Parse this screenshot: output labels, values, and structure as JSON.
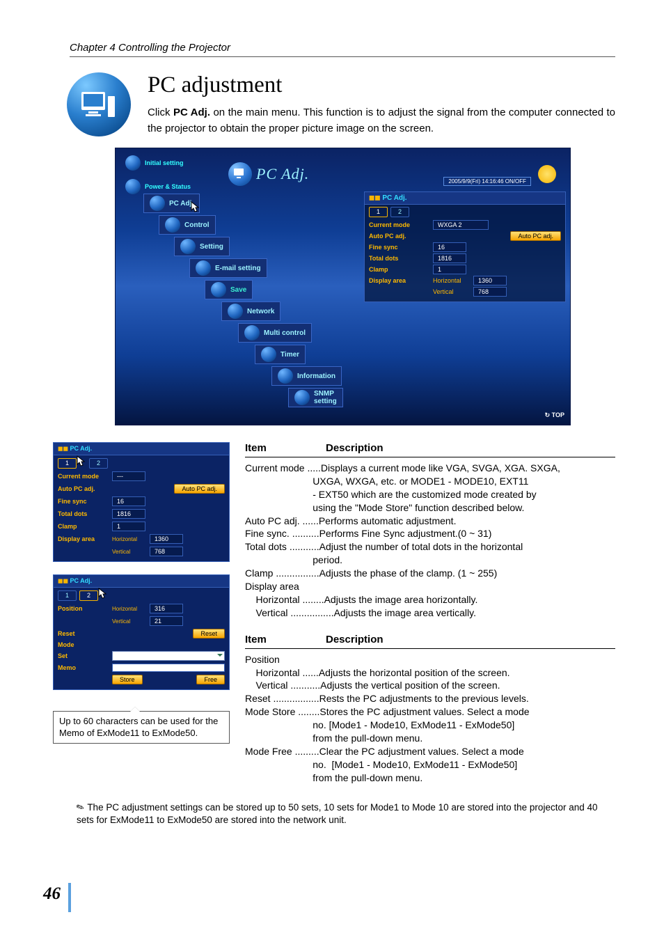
{
  "chapter": "Chapter 4 Controlling the Projector",
  "title": "PC adjustment",
  "intro_prefix": "Click ",
  "intro_bold": "PC Adj.",
  "intro_rest": " on the main menu. This function is to adjust the signal from the computer connected to the projector to obtain the proper picture image on the screen.",
  "ss": {
    "initial": "Initial setting",
    "power": "Power & Status",
    "big": "PC Adj.",
    "date": "2005/9/9(Fri)   14:16:46  ON/OFF",
    "nav": {
      "pcadj": "PC Adj.",
      "control": "Control",
      "setting": "Setting",
      "email": "E-mail setting",
      "save": "Save",
      "network": "Network",
      "multi": "Multi control",
      "timer": "Timer",
      "info": "Information",
      "snmp": "SNMP setting"
    },
    "panel": {
      "title": "PC Adj.",
      "t1": "1",
      "t2": "2",
      "current_mode": "Current mode",
      "current_mode_v": "WXGA 2",
      "auto_pc": "Auto PC adj.",
      "auto_pc_btn": "Auto PC adj.",
      "fine": "Fine sync",
      "fine_v": "16",
      "total": "Total dots",
      "total_v": "1816",
      "clamp": "Clamp",
      "clamp_v": "1",
      "disp": "Display area",
      "horiz": "Horizontal",
      "horiz_v": "1360",
      "vert": "Vertical",
      "vert_v": "768"
    },
    "top": "TOP"
  },
  "mini1": {
    "title": "PC Adj.",
    "t1": "1",
    "t2": "2",
    "current_mode": "Current mode",
    "current_mode_v": "---",
    "auto_pc": "Auto PC adj.",
    "auto_pc_btn": "Auto PC adj.",
    "fine": "Fine sync",
    "fine_v": "16",
    "total": "Total dots",
    "total_v": "1816",
    "clamp": "Clamp",
    "clamp_v": "1",
    "disp": "Display area",
    "horiz": "Horizontal",
    "horiz_v": "1360",
    "vert": "Vertical",
    "vert_v": "768"
  },
  "mini2": {
    "title": "PC Adj.",
    "t1": "1",
    "t2": "2",
    "pos": "Position",
    "horiz": "Horizontal",
    "horiz_v": "316",
    "vert": "Vertical",
    "vert_v": "21",
    "reset": "Reset",
    "reset_btn": "Reset",
    "mode": "Mode",
    "set": "Set",
    "memo": "Memo",
    "store": "Store",
    "free": "Free"
  },
  "memo_note": "Up to 60 characters can be used for the Memo of ExMode11 to ExMode50.",
  "table1": {
    "h_item": "Item",
    "h_desc": "Description",
    "body": "Current mode .....Displays a current mode like VGA, SVGA, XGA. SXGA,\n                         UXGA, WXGA, etc. or MODE1 - MODE10, EXT11\n                         - EXT50 which are the customized mode created by\n                         using the \"Mode Store\" function described below.\nAuto PC adj. ......Performs automatic adjustment.\nFine sync. ..........Performs Fine Sync adjustment.(0 ~ 31)\nTotal dots ...........Adjust the number of total dots in the horizontal\n                         period.\nClamp ................Adjusts the phase of the clamp. (1 ~ 255)\nDisplay area\n    Horizontal ........Adjusts the image area horizontally.\n    Vertical ................Adjusts the image area vertically."
  },
  "table2": {
    "h_item": "Item",
    "h_desc": "Description",
    "body": "Position\n    Horizontal ......Adjusts the horizontal position of the screen.\n    Vertical ...........Adjusts the vertical position of the screen.\nReset .................Rests the PC adjustments to the previous levels.\nMode Store ........Stores the PC adjustment values. Select a mode\n                         no. [Mode1 - Mode10, ExMode11 - ExMode50]\n                         from the pull-down menu.\nMode Free .........Clear the PC adjustment values. Select a mode\n                         no.  [Mode1 - Mode10, ExMode11 - ExMode50]\n                         from the pull-down menu."
  },
  "footnote": "The PC adjustment settings can be stored up to 50 sets, 10 sets for Mode1 to Mode 10 are stored into the projector and 40 sets for ExMode11 to ExMode50 are stored into the network unit.",
  "page_num": "46"
}
